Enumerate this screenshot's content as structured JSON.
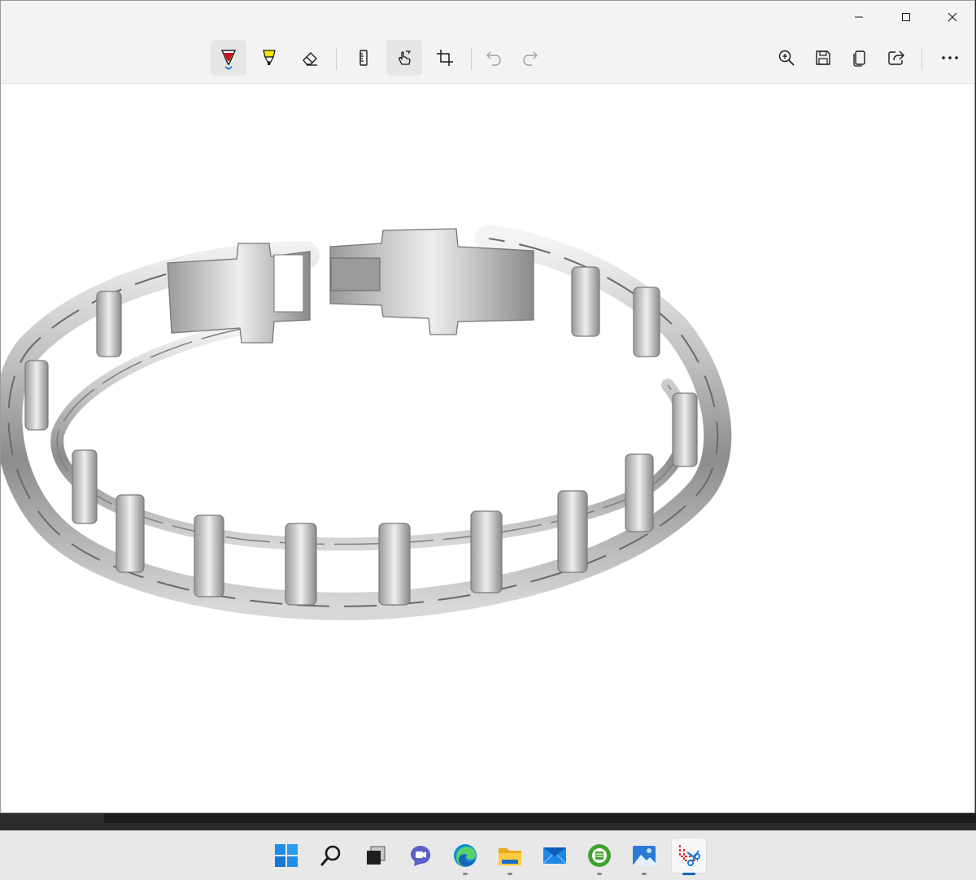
{
  "window": {
    "caption_buttons": [
      {
        "name": "minimize-button",
        "icon": "minimize-icon"
      },
      {
        "name": "maximize-button",
        "icon": "maximize-icon"
      },
      {
        "name": "close-button",
        "icon": "close-icon"
      }
    ]
  },
  "toolbar": {
    "tools": [
      {
        "name": "ballpoint-pen-tool",
        "icon": "pen-icon",
        "color": "#d0121b",
        "active": true
      },
      {
        "name": "highlighter-tool",
        "icon": "highlighter-icon",
        "color": "#ffe600",
        "active": false
      },
      {
        "name": "eraser-tool",
        "icon": "eraser-icon",
        "active": false
      },
      {
        "name": "ruler-tool",
        "icon": "ruler-icon",
        "active": false
      },
      {
        "name": "touch-writing-tool",
        "icon": "touch-writing-icon",
        "active": true
      },
      {
        "name": "crop-tool",
        "icon": "crop-icon",
        "active": false
      },
      {
        "name": "undo-button",
        "icon": "undo-icon",
        "enabled": false
      },
      {
        "name": "redo-button",
        "icon": "redo-icon",
        "enabled": false
      }
    ],
    "actions": [
      {
        "name": "zoom-button",
        "icon": "zoom-in-icon"
      },
      {
        "name": "save-button",
        "icon": "save-icon"
      },
      {
        "name": "copy-button",
        "icon": "copy-icon"
      },
      {
        "name": "share-button",
        "icon": "share-icon"
      },
      {
        "name": "more-button",
        "icon": "more-icon"
      }
    ]
  },
  "canvas": {
    "image": "silver-chain-bracelet-photo",
    "background": "#ffffff"
  },
  "taskbar": {
    "items": [
      {
        "name": "start-button",
        "icon": "windows-logo-icon",
        "running": false
      },
      {
        "name": "search-button",
        "icon": "search-icon",
        "running": false
      },
      {
        "name": "task-view-button",
        "icon": "task-view-icon",
        "running": false
      },
      {
        "name": "chat-button",
        "icon": "chat-icon",
        "running": false
      },
      {
        "name": "edge-button",
        "icon": "edge-icon",
        "running": true
      },
      {
        "name": "file-explorer-button",
        "icon": "folder-icon",
        "running": true
      },
      {
        "name": "mail-button",
        "icon": "mail-icon",
        "running": false
      },
      {
        "name": "app-green-button",
        "icon": "green-app-icon",
        "running": true
      },
      {
        "name": "photos-button",
        "icon": "photos-icon",
        "running": true
      },
      {
        "name": "snipping-tool-button",
        "icon": "snipping-tool-icon",
        "running": true,
        "active": true
      }
    ]
  },
  "colors": {
    "accent": "#0067c0",
    "toolbar_bg": "#f3f3f3",
    "taskbar_bg": "#e8e8e8"
  }
}
